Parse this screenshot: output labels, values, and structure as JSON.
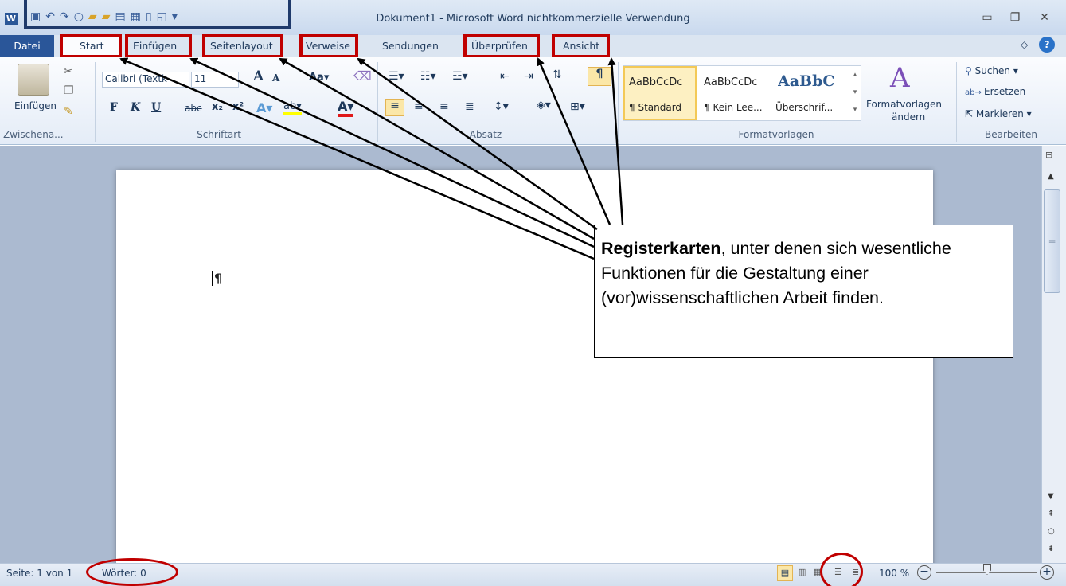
{
  "window": {
    "title": "Dokument1 - Microsoft Word nichtkommerzielle Verwendung",
    "app_icon": "W"
  },
  "tabs": [
    {
      "label": "Datei"
    },
    {
      "label": "Start"
    },
    {
      "label": "Einfügen"
    },
    {
      "label": "Seitenlayout"
    },
    {
      "label": "Verweise"
    },
    {
      "label": "Sendungen"
    },
    {
      "label": "Überprüfen"
    },
    {
      "label": "Ansicht"
    }
  ],
  "ribbon": {
    "clipboard": {
      "paste_label": "Einfügen",
      "group_label": "Zwischena..."
    },
    "font": {
      "font_name": "Calibri (Textk",
      "font_size": "11",
      "group_label": "Schriftart",
      "bold": "F",
      "italic": "K",
      "underline": "U"
    },
    "paragraph": {
      "group_label": "Absatz"
    },
    "styles": {
      "group_label": "Formatvorlagen",
      "items": [
        {
          "preview": "AaBbCcDc",
          "name": "¶ Standard"
        },
        {
          "preview": "AaBbCcDc",
          "name": "¶ Kein Lee..."
        },
        {
          "preview": "AaBbC",
          "name": "Überschrif..."
        }
      ],
      "change_label_1": "Formatvorlagen",
      "change_label_2": "ändern"
    },
    "editing": {
      "group_label": "Bearbeiten",
      "find": "Suchen",
      "replace": "Ersetzen",
      "select": "Markieren"
    }
  },
  "document": {
    "cursor_mark": "¶"
  },
  "callout": {
    "bold": "Registerkarten",
    "text": ", unter denen sich wesentliche Funktionen für die Gestaltung einer (vor)wissenschaftlichen Arbeit finden."
  },
  "status": {
    "page": "Seite: 1 von 1",
    "words": "Wörter: 0",
    "zoom": "100 %"
  },
  "colors": {
    "highlight": "#c00000",
    "qat_box": "#1f3a6b",
    "file_tab": "#2a5699"
  }
}
